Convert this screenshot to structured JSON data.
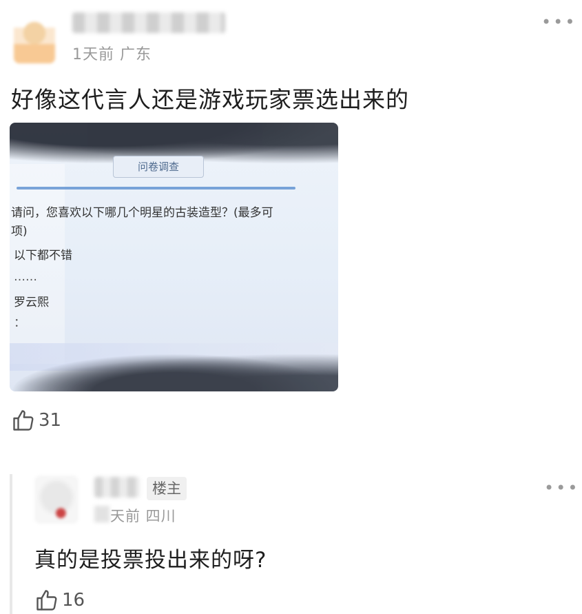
{
  "post": {
    "meta": "1天前 广东",
    "text": "好像这代言人还是游戏玩家票选出来的",
    "likes": "31",
    "more_icon": "more-dots-icon",
    "like_icon": "thumbs-up-icon",
    "image": {
      "title": "问卷调查",
      "question_line1": "请问，您喜欢以下哪几个明星的古装造型？(最多可",
      "question_line2": "项)",
      "option1": "以下都不错",
      "option2": "……",
      "option3": "罗云熙",
      "option4": "："
    }
  },
  "reply": {
    "badge": "楼主",
    "meta": "天前 四川",
    "text": "真的是投票投出来的呀?",
    "likes": "16"
  },
  "colors": {
    "meta_text": "#999999",
    "accent_blue": "#5a8fd0",
    "badge_bg": "#f0f0f0"
  }
}
